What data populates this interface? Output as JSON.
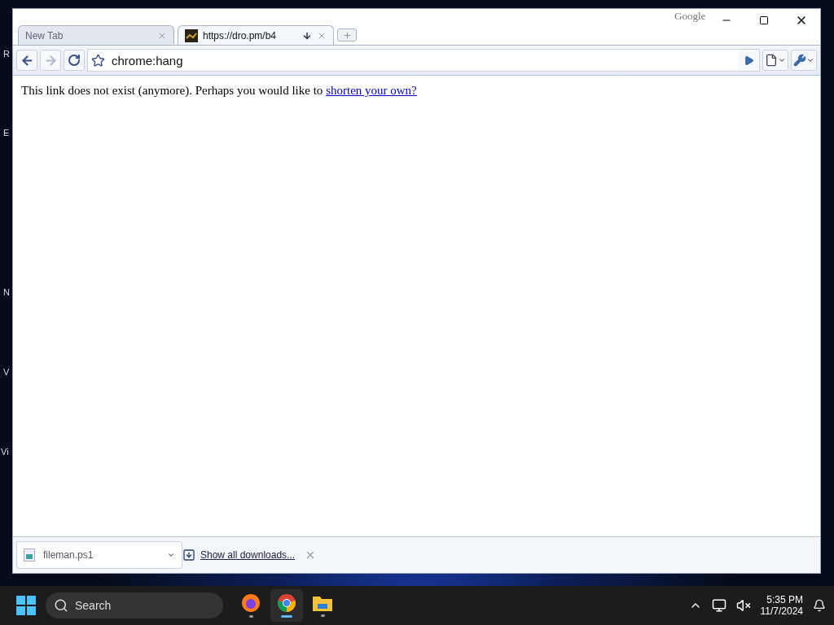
{
  "desktop": {
    "icon_labels": [
      "R",
      "E",
      "N",
      "V",
      "Vi"
    ]
  },
  "browser": {
    "brand": "Google",
    "tabs": [
      {
        "title": "New Tab",
        "selected": false
      },
      {
        "title": "https://dro.pm/b4",
        "selected": true
      }
    ],
    "address": "chrome:hang",
    "page": {
      "text": "This link does not exist (anymore). Perhaps you would like to ",
      "link": "shorten your own?"
    },
    "downloads": {
      "items": [
        {
          "filename": "fileman.ps1"
        }
      ],
      "show_all": "Show all downloads..."
    }
  },
  "taskbar": {
    "search_label": "Search",
    "apps": [
      {
        "kind": "firefox",
        "active": false
      },
      {
        "kind": "chrome",
        "active": true
      },
      {
        "kind": "files",
        "active": false
      }
    ],
    "time": "5:35 PM",
    "date": "11/7/2024"
  }
}
